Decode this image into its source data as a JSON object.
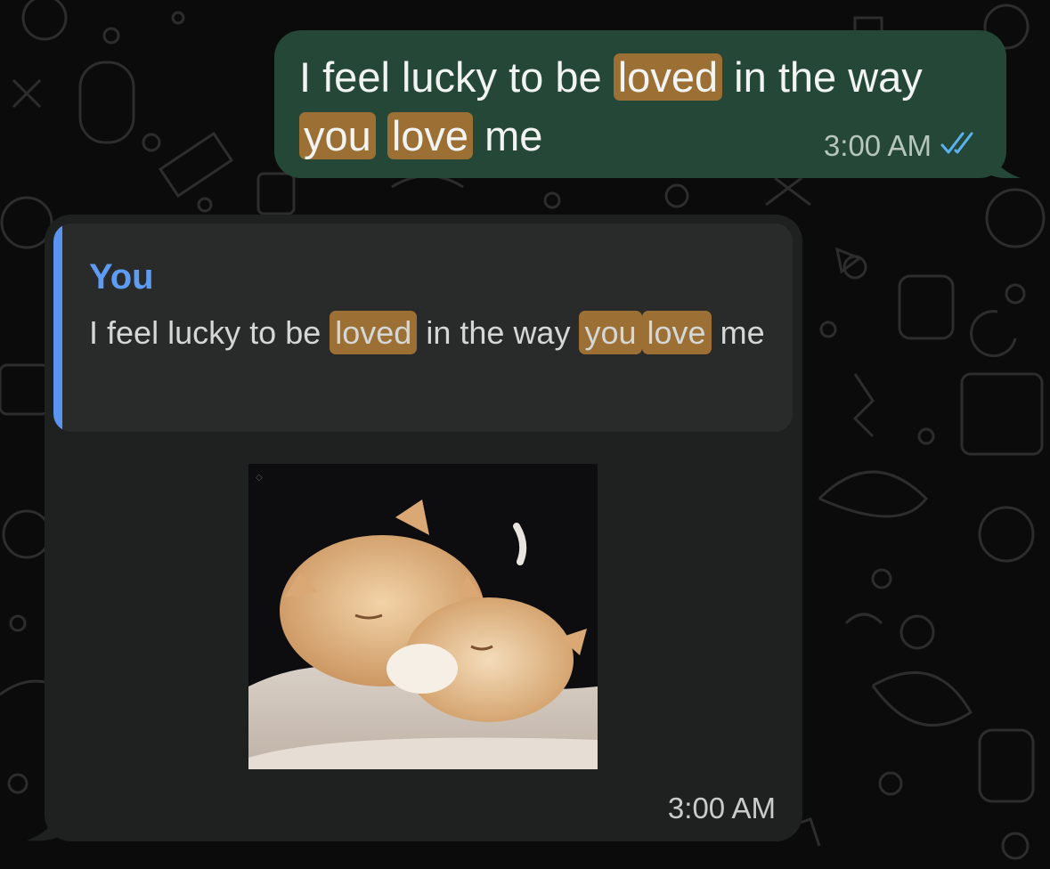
{
  "colors": {
    "outgoing_bubble": "#244737",
    "incoming_bubble": "#1f2121",
    "quote_bar": "#5a93f0",
    "highlight": "#9c7034",
    "read_ticks": "#5ab3f0"
  },
  "outgoing_message": {
    "words": [
      "I",
      "feel",
      "lucky",
      "to",
      "be",
      "loved",
      "in",
      "the",
      "way",
      "you",
      "love",
      "me"
    ],
    "highlighted_words": [
      "loved",
      "you",
      "love"
    ],
    "time": "3:00 AM",
    "status_icon": "double-check-icon"
  },
  "incoming_message": {
    "quote": {
      "author": "You",
      "words": [
        "I",
        "feel",
        "lucky",
        "to",
        "be",
        "loved",
        "in",
        "the",
        "way",
        "you",
        "love",
        "me"
      ],
      "highlighted_words": [
        "loved",
        "you",
        "love"
      ]
    },
    "media": {
      "kind": "gif",
      "subject": "two-kittens-cuddling"
    },
    "time": "3:00 AM"
  }
}
